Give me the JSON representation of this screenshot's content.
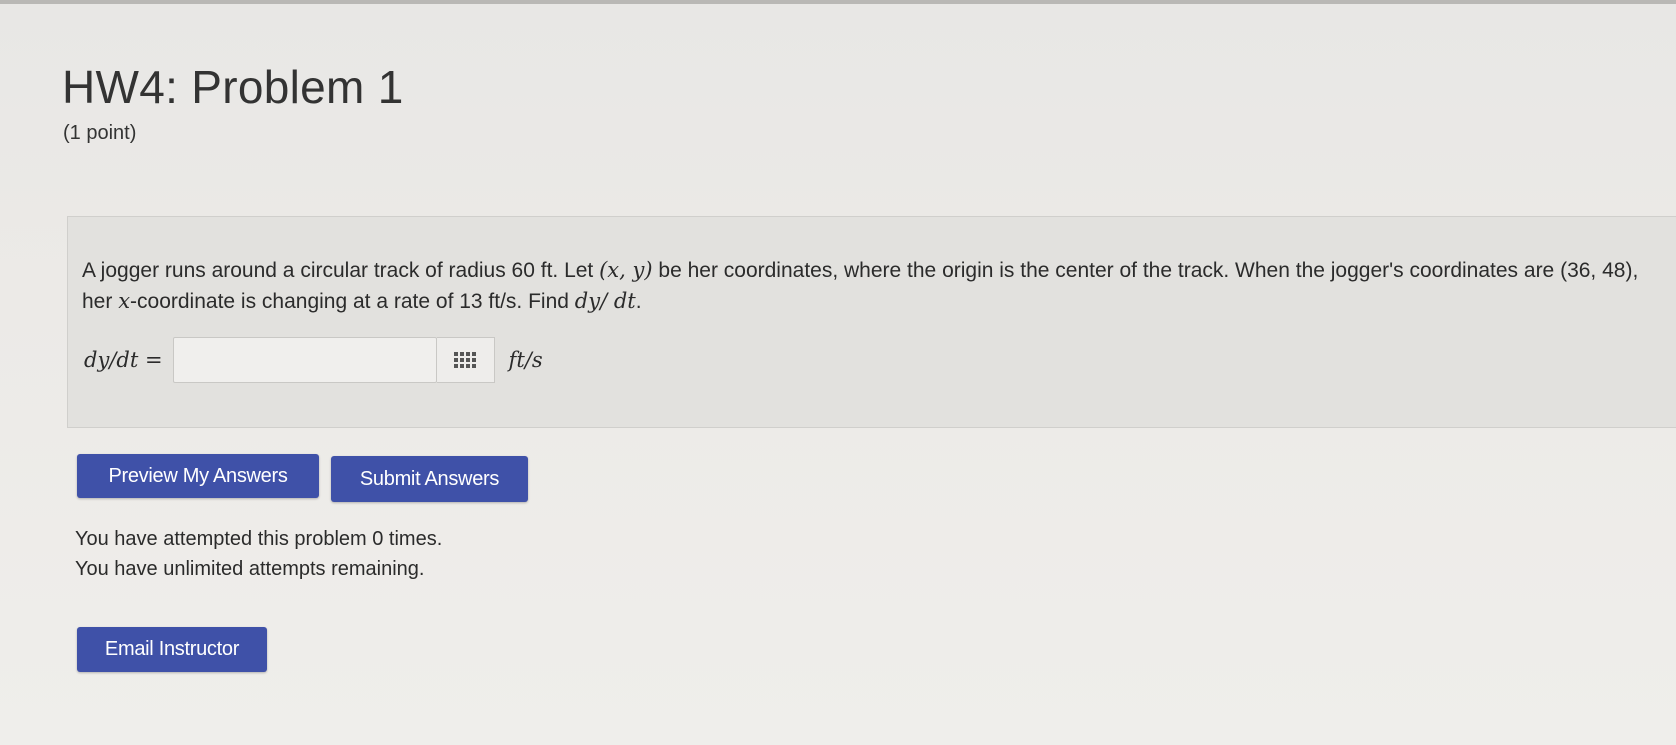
{
  "page": {
    "title": "HW4: Problem 1",
    "points": "(1 point)"
  },
  "problem": {
    "text_1": "A jogger runs around a circular track of radius 60 ft. Let ",
    "math_xy": "(x, y)",
    "text_2": " be her coordinates, where the origin is the center of the track. When the jogger's coordinates are (36, 48), her ",
    "math_x": "x",
    "text_3": "-coordinate is changing at a rate of 13 ft/s. Find ",
    "math_dydt": "dy/ dt",
    "text_4": "."
  },
  "answer": {
    "label": "dy/dt =",
    "value": "",
    "placeholder": "",
    "unit": "ft/s"
  },
  "buttons": {
    "preview_label": "Preview My Answers",
    "submit_label": "Submit Answers",
    "email_label": "Email Instructor"
  },
  "status": {
    "attempts_line": "You have attempted this problem 0 times.",
    "remaining_line": "You have unlimited attempts remaining."
  },
  "icons": {
    "equation_palette": "grid-icon"
  },
  "colors": {
    "button_bg": "#3f51a8",
    "button_text": "#ffffff",
    "problem_bg": "#e2e1de"
  }
}
